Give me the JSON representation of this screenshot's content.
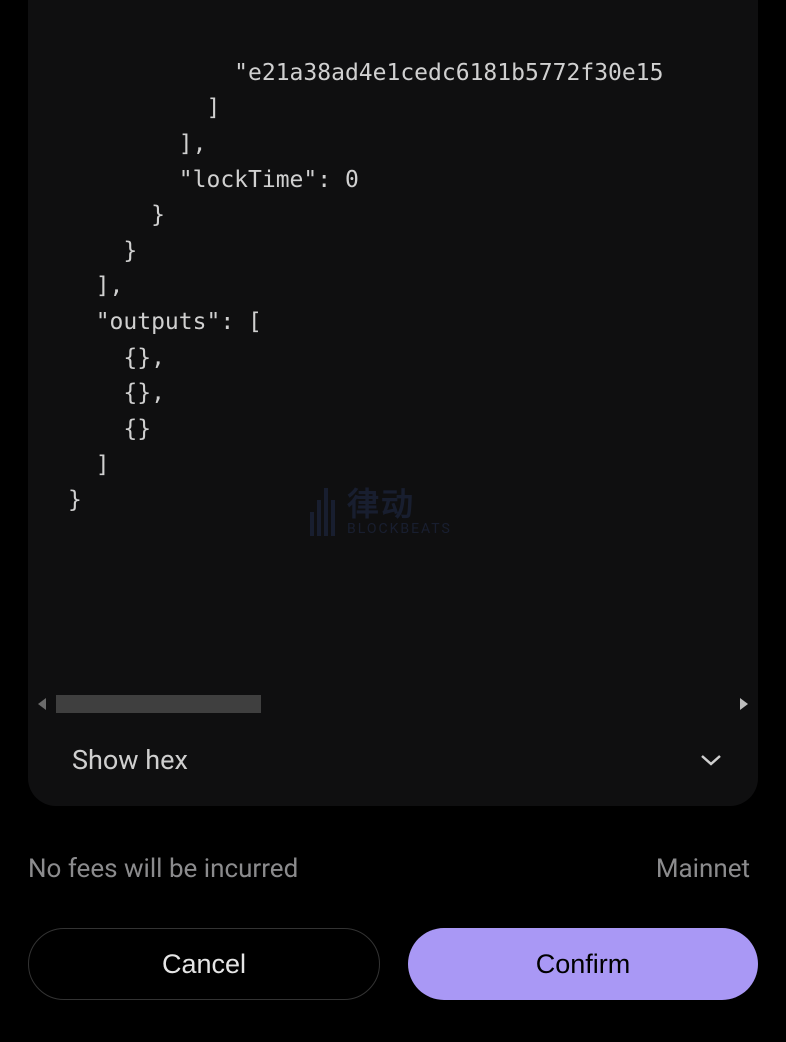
{
  "code": {
    "lines": [
      "            \"e21a38ad4e1cedc6181b5772f30e15",
      "          ]",
      "        ],",
      "        \"lockTime\": 0",
      "      }",
      "    }",
      "  ],",
      "  \"outputs\": [",
      "    {},",
      "    {},",
      "    {}",
      "  ]",
      "}"
    ]
  },
  "controls": {
    "show_hex_label": "Show hex"
  },
  "info": {
    "fees_text": "No fees will be incurred",
    "network": "Mainnet"
  },
  "buttons": {
    "cancel": "Cancel",
    "confirm": "Confirm"
  },
  "watermark": {
    "cn": "律动",
    "en": "BLOCKBEATS"
  }
}
